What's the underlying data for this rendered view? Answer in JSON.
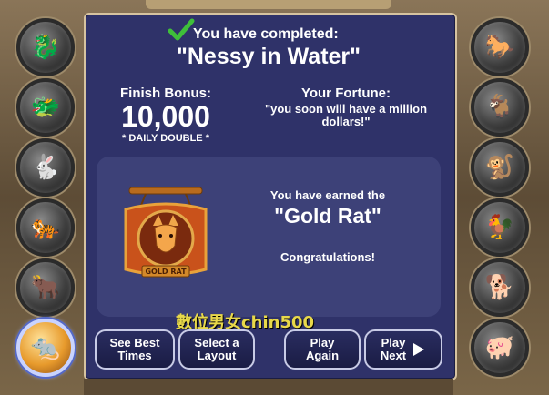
{
  "header": {
    "completed_label": "You have completed:",
    "puzzle_name": "\"Nessy in Water\""
  },
  "bonus": {
    "label": "Finish Bonus:",
    "value": "10,000",
    "note": "* DAILY DOUBLE *"
  },
  "fortune": {
    "label": "Your Fortune:",
    "text": "\"you soon will have a million dollars!\""
  },
  "award": {
    "earned_label": "You have earned the",
    "award_name": "\"Gold Rat\"",
    "congrats": "Congratulations!",
    "plaque_text": "GOLD RAT"
  },
  "buttons": {
    "see_best_times": "See Best\nTimes",
    "select_layout": "Select a\nLayout",
    "play_again": "Play\nAgain",
    "play_next": "Play\nNext"
  },
  "watermark": "數位男女chin500",
  "left_medals": [
    "dragon-icon",
    "dragon-head-icon",
    "rabbit-icon",
    "tiger-icon",
    "ox-icon",
    "rat-icon"
  ],
  "right_medals": [
    "horse-icon",
    "goat-icon",
    "monkey-icon",
    "rooster-icon",
    "dog-icon",
    "pig-icon"
  ],
  "colors": {
    "panel": "#2f3269",
    "check": "#3fbf3a",
    "gold": "#e79a2c"
  }
}
